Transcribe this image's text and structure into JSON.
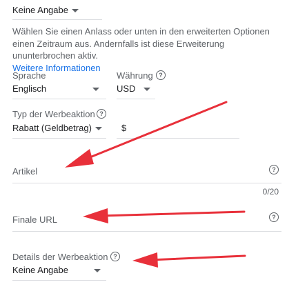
{
  "top_select": {
    "value": "Keine Angabe"
  },
  "help": {
    "text": "Wählen Sie einen Anlass oder unten in den erweiterten Optionen einen Zeitraum aus. Andernfalls ist diese Erweiterung ununterbrochen aktiv.",
    "link": "Weitere Informationen"
  },
  "language": {
    "label": "Sprache",
    "value": "Englisch"
  },
  "currency": {
    "label": "Währung",
    "value": "USD"
  },
  "promo_type": {
    "label": "Typ der Werbeaktion",
    "value": "Rabatt (Geldbetrag)",
    "currency_symbol": "$"
  },
  "item": {
    "placeholder": "Artikel",
    "counter": "0/20"
  },
  "final_url": {
    "placeholder": "Finale URL"
  },
  "promo_details": {
    "label": "Details der Werbeaktion",
    "value": "Keine Angabe"
  },
  "colors": {
    "arrow": "#e8303a",
    "link": "#1a73e8"
  }
}
